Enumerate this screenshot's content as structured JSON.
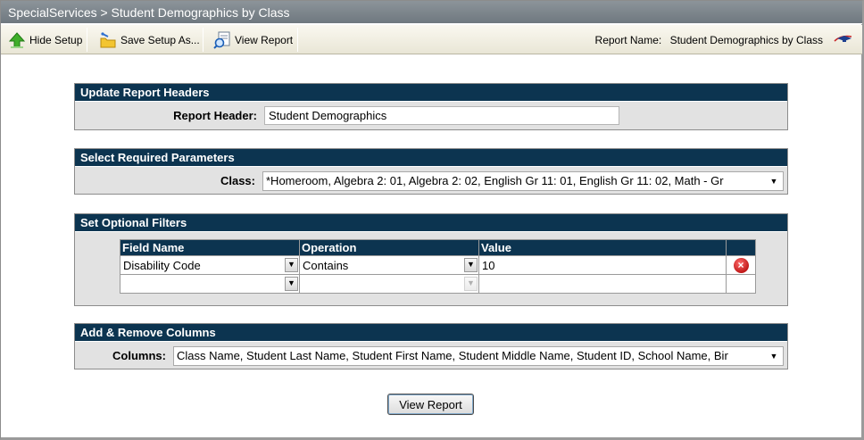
{
  "window": {
    "title": "SpecialServices > Student Demographics by Class"
  },
  "toolbar": {
    "hide_setup": "Hide Setup",
    "save_setup_as": "Save Setup As...",
    "view_report": "View Report",
    "report_name_label": "Report Name:",
    "report_name_value": "Student Demographics by Class"
  },
  "headers_panel": {
    "title": "Update Report Headers",
    "report_header_label": "Report Header:",
    "report_header_value": "Student Demographics"
  },
  "params_panel": {
    "title": "Select Required Parameters",
    "class_label": "Class:",
    "class_value": "*Homeroom, Algebra 2: 01, Algebra 2: 02, English Gr 11: 01, English Gr 11: 02, Math - Gr"
  },
  "filters_panel": {
    "title": "Set Optional Filters",
    "columns": [
      "Field Name",
      "Operation",
      "Value"
    ],
    "rows": [
      {
        "field": "Disability Code",
        "operation": "Contains",
        "value": "10"
      },
      {
        "field": "",
        "operation": "",
        "value": ""
      }
    ]
  },
  "columns_panel": {
    "title": "Add & Remove Columns",
    "columns_label": "Columns:",
    "columns_value": "Class Name, Student Last Name, Student First Name, Student Middle Name, Student ID, School Name, Bir"
  },
  "footer": {
    "view_report_button": "View Report"
  },
  "icons": {
    "hide_setup": "up-arrow-icon",
    "save_setup": "folder-save-icon",
    "view_report": "magnifier-report-icon",
    "delete": "delete-icon",
    "dropdown": "chevron-down-icon"
  }
}
